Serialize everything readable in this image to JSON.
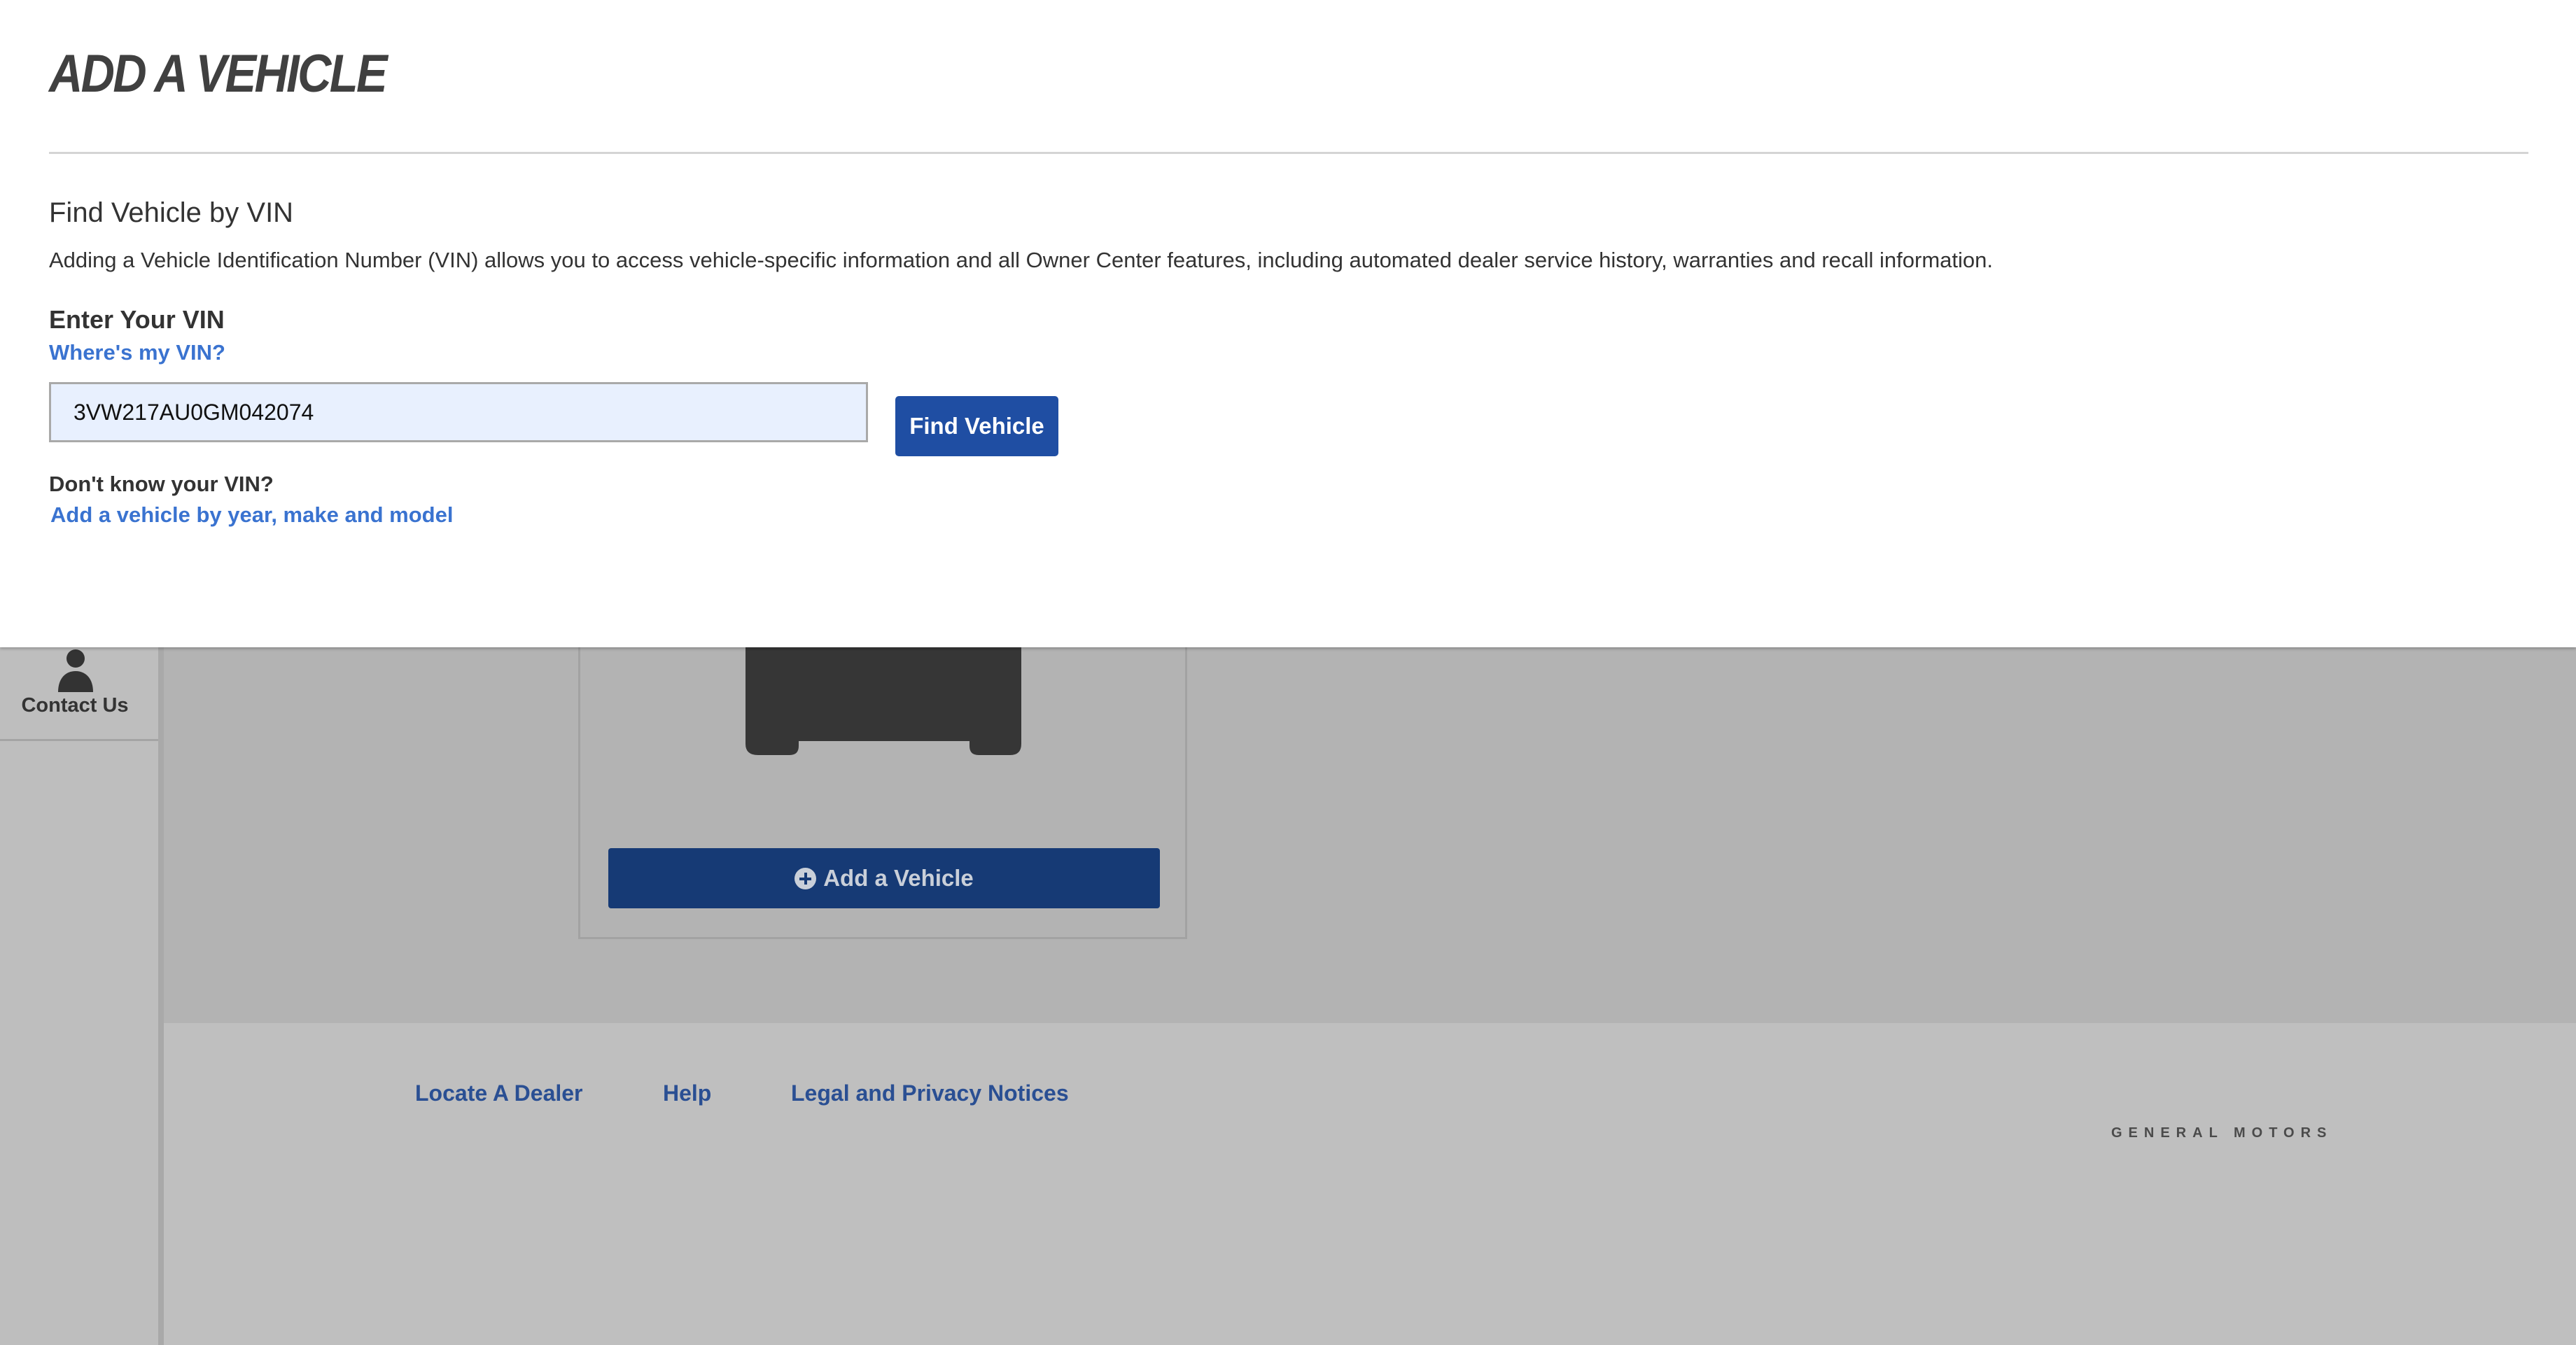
{
  "modal": {
    "title": "ADD A VEHICLE",
    "section_title": "Find Vehicle by VIN",
    "description": "Adding a Vehicle Identification Number (VIN) allows you to access vehicle-specific information and all Owner Center features, including automated dealer service history, warranties and recall information.",
    "vin_label": "Enter Your VIN",
    "where_vin_link": "Where's my VIN?",
    "vin_value": "3VW217AU0GM042074",
    "find_button": "Find Vehicle",
    "dont_know_label": "Don't know your VIN?",
    "ymm_link": "Add a vehicle by year, make and model"
  },
  "sidebar": {
    "contact_label": "Contact Us",
    "contact_icon": "person-icon"
  },
  "vehicle_card": {
    "car_icon": "car-icon",
    "add_button_icon": "plus-circle-icon",
    "add_button_label": "Add a Vehicle"
  },
  "footer": {
    "links": [
      "Locate A Dealer",
      "Help",
      "Legal and Privacy Notices"
    ],
    "brand": "GENERAL MOTORS"
  },
  "colors": {
    "primary_button": "#1f4ea3",
    "link": "#3a73d0",
    "dimmed_button": "#163a75",
    "footer_link": "#2a4f93",
    "input_fill": "#e8f0fe",
    "overlay_gray": "#b3b3b3"
  }
}
